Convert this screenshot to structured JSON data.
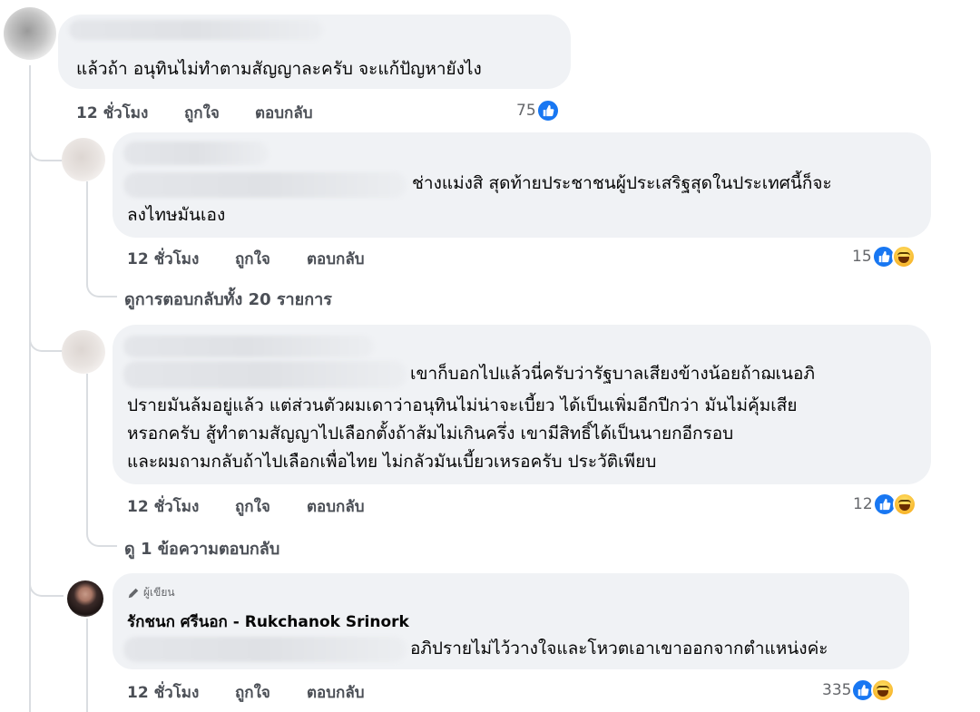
{
  "comments": [
    {
      "text_lines": [
        "แล้วถ้า อนุทินไม่ทำตามสัญญาละครับ จะแก้ปัญหายังไง"
      ],
      "time": "12 ชั่วโมง",
      "like": "ถูกใจ",
      "reply": "ตอบกลับ",
      "reaction_count": "75"
    },
    {
      "text_lines": [
        "ช่างแม่งสิ สุดท้ายประชาชนผู้ประเสริฐสุดในประเทศนี้ก็จะ",
        "ลงไทษมันเอง"
      ],
      "time": "12 ชั่วโมง",
      "like": "ถูกใจ",
      "reply": "ตอบกลับ",
      "reaction_count": "15",
      "view_replies": "ดูการตอบกลับทั้ง 20 รายการ"
    },
    {
      "text_lines": [
        "เขาก็บอกไปแล้วนี่ครับว่ารัฐบาลเสียงข้างน้อยถ้าฌเนอภิ",
        "ปรายมันล้มอยู่แล้ว แต่ส่วนตัวผมเดาว่าอนุทินไม่น่าจะเบี้ยว ได้เป็นเพิ่มอีกปีกว่า มันไม่คุ้มเสีย",
        "หรอกครับ สู้ทำตามสัญญาไปเลือกตั้งถ้าส้มไม่เกินครึ่ง เขามีสิทธิ์ได้เป็นนายกอีกรอบ",
        "และผมถามกลับถ้าไปเลือกเพื่อไทย ไม่กลัวมันเบี้ยวเหรอครับ ประวัติเพียบ"
      ],
      "time": "12 ชั่วโมง",
      "like": "ถูกใจ",
      "reply": "ตอบกลับ",
      "reaction_count": "12",
      "view_replies": "ดู 1 ข้อความตอบกลับ"
    },
    {
      "author_badge": "ผู้เขียน",
      "author_name": "รักชนก ศรีนอก - Rukchanok Srinork",
      "text_lines": [
        "อภิปรายไม่ไว้วางใจและโหวตเอาเขาออกจากตำแหน่งค่ะ"
      ],
      "time": "12 ชั่วโมง",
      "like": "ถูกใจ",
      "reply": "ตอบกลับ",
      "reaction_count": "335"
    }
  ],
  "icons": {
    "like": "like-reaction-icon",
    "haha": "haha-reaction-icon",
    "pencil": "pencil-icon"
  },
  "colors": {
    "bubble": "#f0f2f5",
    "like_blue": "#1877f2",
    "thread_line": "#dadde1"
  }
}
